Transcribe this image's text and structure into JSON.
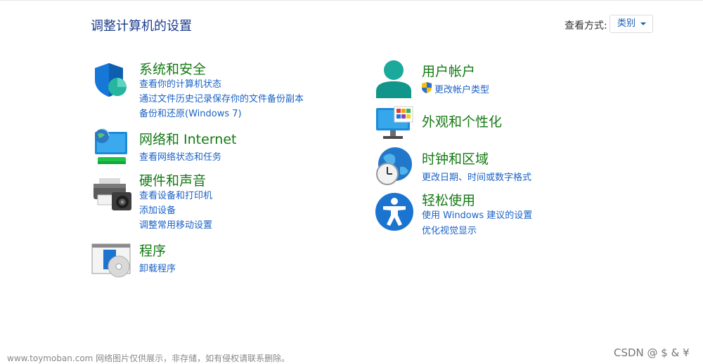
{
  "header": {
    "title": "调整计算机的设置",
    "view_label": "查看方式:",
    "view_value": "类别"
  },
  "left": {
    "system": {
      "title": "系统和安全",
      "links": [
        "查看你的计算机状态",
        "通过文件历史记录保存你的文件备份副本",
        "备份和还原(Windows 7)"
      ]
    },
    "network": {
      "title": "网络和 Internet",
      "links": [
        "查看网络状态和任务"
      ]
    },
    "hardware": {
      "title": "硬件和声音",
      "links": [
        "查看设备和打印机",
        "添加设备",
        "调整常用移动设置"
      ]
    },
    "programs": {
      "title": "程序",
      "links": [
        "卸载程序"
      ]
    }
  },
  "right": {
    "accounts": {
      "title": "用户帐户",
      "links": [
        "更改帐户类型"
      ]
    },
    "appearance": {
      "title": "外观和个性化"
    },
    "clock": {
      "title": "时钟和区域",
      "links": [
        "更改日期、时间或数字格式"
      ]
    },
    "ease": {
      "title": "轻松使用",
      "links": [
        "使用 Windows 建议的设置",
        "优化视觉显示"
      ]
    }
  },
  "watermark": {
    "left": "www.toymoban.com 网络图片仅供展示，非存储，如有侵权请联系删除。",
    "right": "CSDN @ $ & ¥"
  },
  "colors": {
    "category_title": "#157a15",
    "link": "#1a62c6",
    "page_title": "#1b3b8a"
  },
  "icons": [
    "shield-icon",
    "network-monitor-icon",
    "printer-camera-icon",
    "programs-disc-icon",
    "user-icon",
    "uac-shield-icon",
    "display-palette-icon",
    "clock-globe-icon",
    "accessibility-icon"
  ]
}
